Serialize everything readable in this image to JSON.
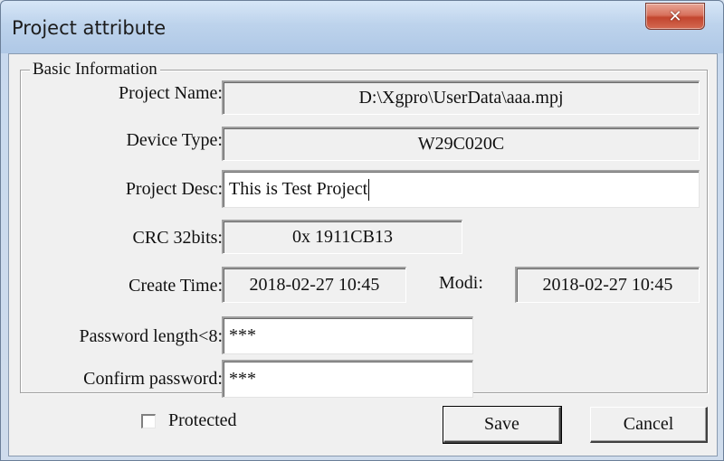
{
  "window": {
    "title": "Project attribute"
  },
  "group": {
    "title": "Basic Information"
  },
  "fields": {
    "project_name": {
      "label": "Project Name:",
      "value": "D:\\Xgpro\\UserData\\aaa.mpj"
    },
    "device_type": {
      "label": "Device Type:",
      "value": "W29C020C"
    },
    "project_desc": {
      "label": "Project Desc:",
      "value": "This is Test Project"
    },
    "crc": {
      "label": "CRC 32bits:",
      "value": "0x 1911CB13"
    },
    "create_time": {
      "label": "Create Time:",
      "value": "2018-02-27 10:45"
    },
    "modi_time": {
      "label": "Modi:",
      "value": "2018-02-27 10:45"
    },
    "password": {
      "label": "Password length<8:",
      "value": "***"
    },
    "confirm_password": {
      "label": "Confirm password:",
      "value": "***"
    }
  },
  "protected": {
    "label": "Protected",
    "checked": false
  },
  "buttons": {
    "save": "Save",
    "cancel": "Cancel"
  },
  "icons": {
    "close": "close-icon"
  }
}
